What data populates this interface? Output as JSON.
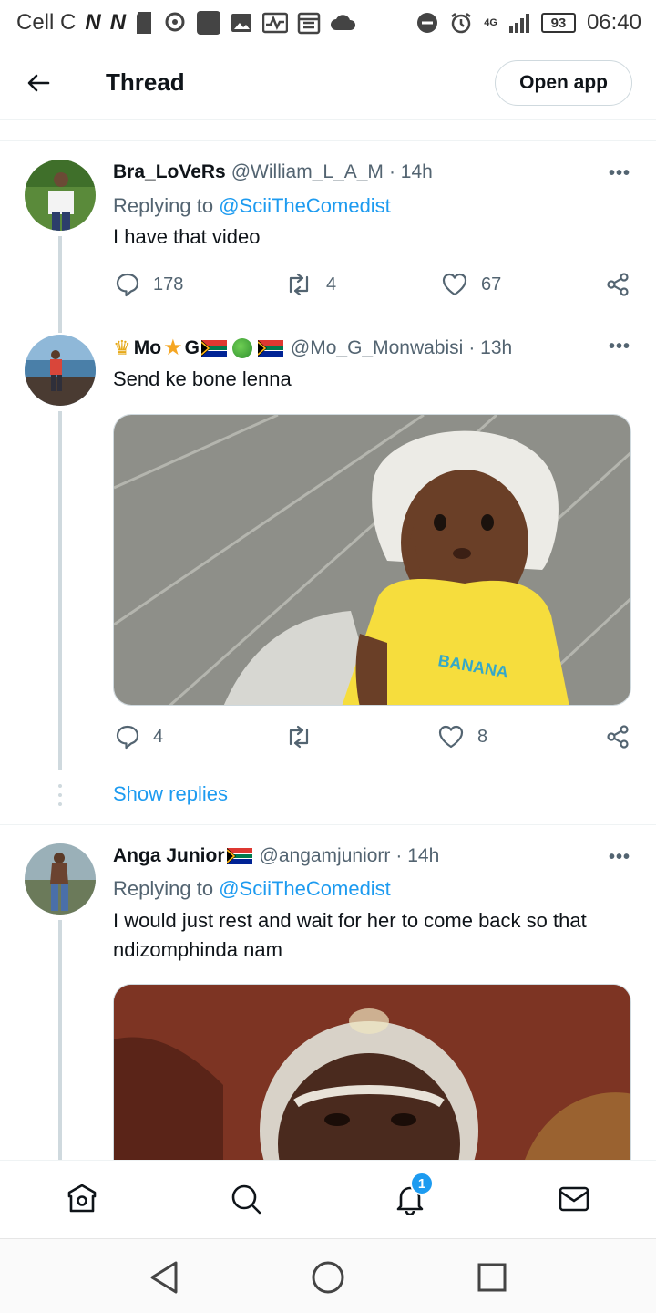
{
  "status_bar": {
    "carrier": "Cell C",
    "network": "4G",
    "battery": "93",
    "time": "06:40"
  },
  "header": {
    "title": "Thread",
    "open_app_label": "Open app"
  },
  "tweets": [
    {
      "name": "Bra_LoVeRs",
      "handle": "@William_L_A_M",
      "time": "· 14h",
      "replying_prefix": "Replying to ",
      "replying_to": "@SciiTheComedist",
      "text": "I have that video",
      "replies": "178",
      "retweets": "4",
      "likes": "67"
    },
    {
      "name_parts": [
        "Mo",
        "G"
      ],
      "handle": "@Mo_G_Monwabisi",
      "time": "· 13h",
      "text": "Send ke bone lenna",
      "replies": "4",
      "retweets": "",
      "likes": "8",
      "show_replies": "Show replies",
      "image_text": "BANANA"
    },
    {
      "name": "Anga Junior",
      "handle": "@angamjuniorr",
      "time": "· 14h",
      "replying_prefix": "Replying to ",
      "replying_to": "@SciiTheComedist",
      "text": "I would just rest and wait for her to come back so that ndizomphinda nam"
    }
  ],
  "bottom_nav": {
    "notifications_badge": "1"
  },
  "colors": {
    "accent": "#1d9bf0",
    "secondary_text": "#536471",
    "primary_text": "#0f1419"
  }
}
